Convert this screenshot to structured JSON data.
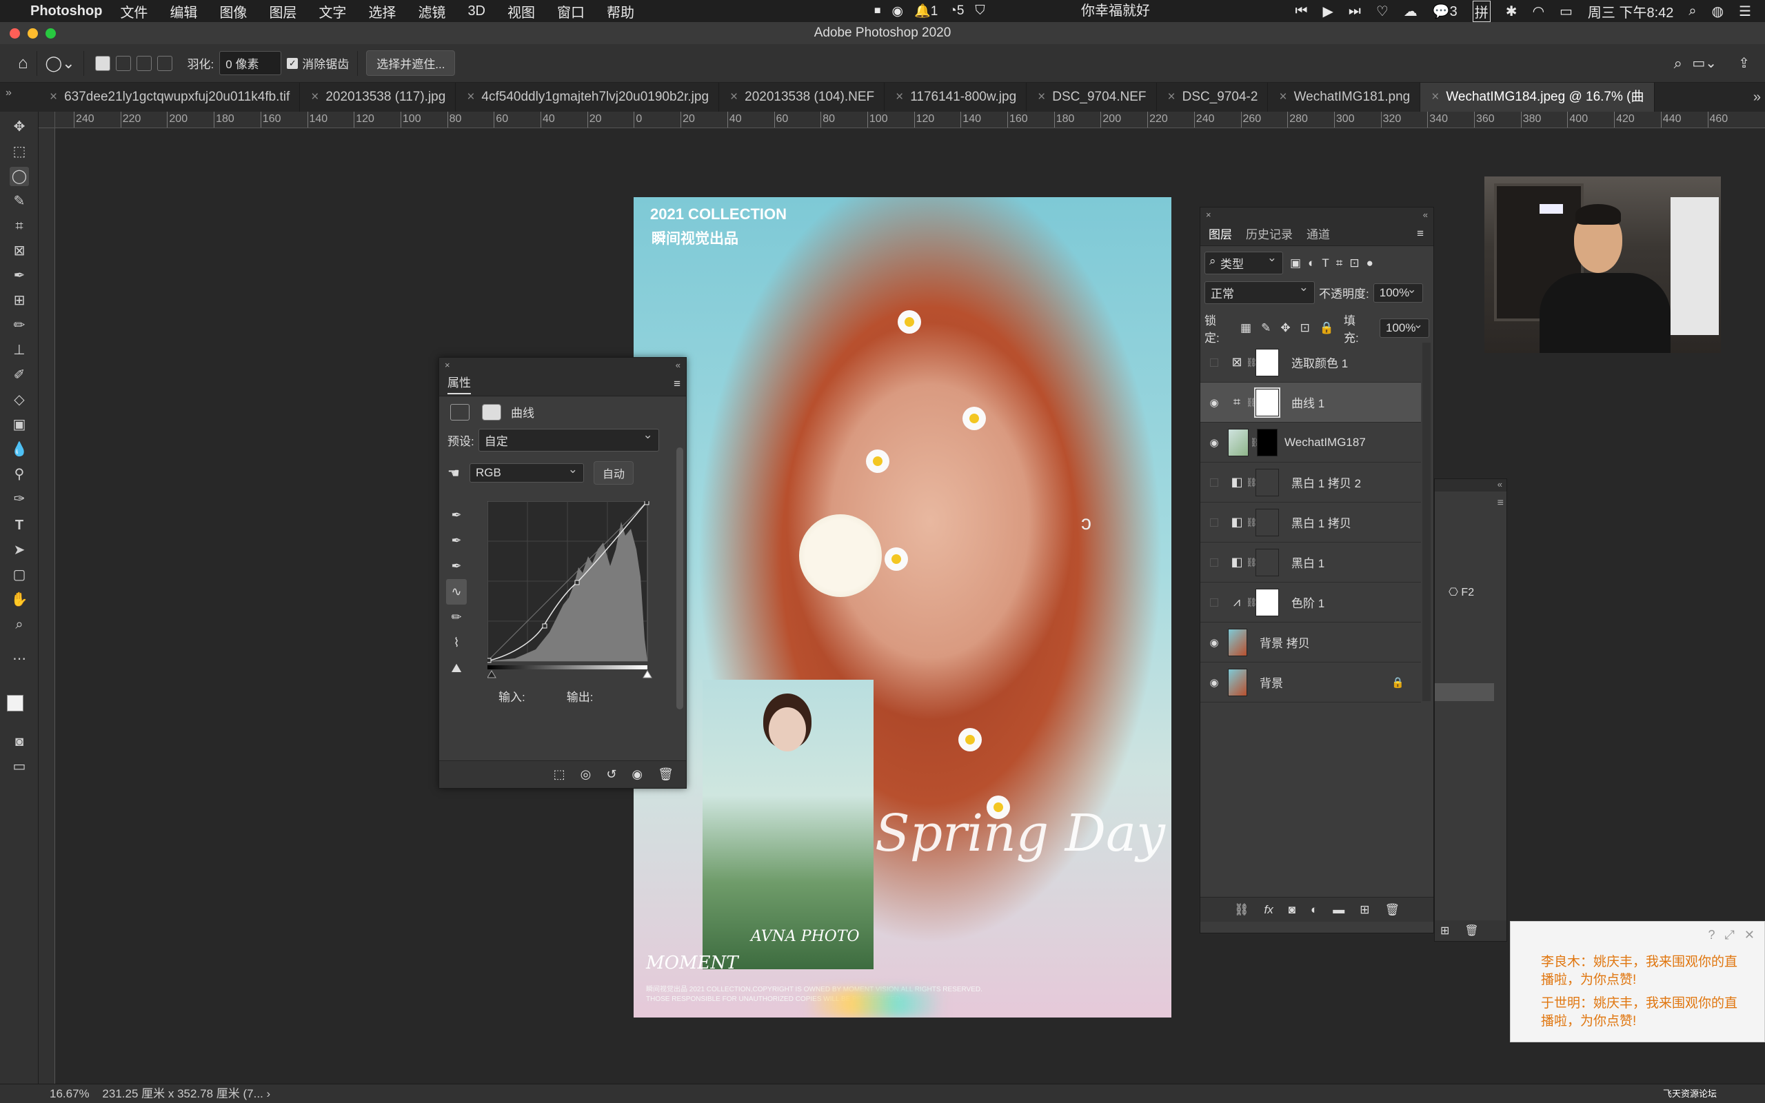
{
  "menubar": {
    "app": "Photoshop",
    "items": [
      "文件",
      "编辑",
      "图像",
      "图层",
      "文字",
      "选择",
      "滤镜",
      "3D",
      "视图",
      "窗口",
      "帮助"
    ],
    "status_badge_1": "1",
    "status_badge_2": "5",
    "song": "你幸福就好",
    "wechat_count": "3",
    "input_method": "拼",
    "clock": "周三 下午8:42"
  },
  "window": {
    "title": "Adobe Photoshop 2020"
  },
  "options": {
    "feather_label": "羽化:",
    "feather_value": "0 像素",
    "antialias_label": "消除锯齿",
    "select_mask_button": "选择并遮住..."
  },
  "tabs": [
    "637dee21ly1gctqwupxfuj20u011k4fb.tif",
    "202013538 (117).jpg",
    "4cf540ddly1gmajteh7lvj20u0190b2r.jpg",
    "202013538 (104).NEF",
    "1176141-800w.jpg",
    "DSC_9704.NEF",
    "DSC_9704-2",
    "WechatIMG181.png",
    "WechatIMG184.jpeg @ 16.7% (曲"
  ],
  "ruler": {
    "h_labels": [
      "240",
      "220",
      "200",
      "180",
      "160",
      "140",
      "120",
      "100",
      "80",
      "60",
      "40",
      "20",
      "0",
      "20",
      "40",
      "60",
      "80",
      "100",
      "120",
      "140",
      "160",
      "180",
      "200",
      "220",
      "240",
      "260",
      "280",
      "300",
      "320",
      "340",
      "360",
      "380",
      "400",
      "420",
      "440",
      "460"
    ]
  },
  "poster": {
    "heading": "2021 COLLECTION",
    "subheading": "瞬间视觉出品",
    "script_text": "Spring Day",
    "brand": "MOMENT",
    "inset_brand": "AVNA PHOTO",
    "footer_line1": "瞬间视觉出品 2021 COLLECTION,COPYRIGHT IS OWNED BY MOMENT VISION.ALL RIGHTS RESERVED.",
    "footer_line2": "THOSE RESPONSIBLE FOR UNAUTHORIZED COPIES WILL BE PROSECUTED."
  },
  "properties": {
    "tab": "属性",
    "type_label": "曲线",
    "preset_label": "预设:",
    "preset_value": "自定",
    "channel": "RGB",
    "auto_button": "自动",
    "input_label": "输入:",
    "output_label": "输出:"
  },
  "layers_panel": {
    "tabs": [
      "图层",
      "历史记录",
      "通道"
    ],
    "filter_kind": "类型",
    "blend_mode": "正常",
    "opacity_label": "不透明度:",
    "opacity": "100%",
    "lock_label": "锁定:",
    "fill_label": "填充:",
    "fill": "100%",
    "layers": [
      {
        "name": "选取颜色 1",
        "visible": false,
        "kind": "adjustment"
      },
      {
        "name": "曲线 1",
        "visible": true,
        "kind": "adjustment",
        "selected": true
      },
      {
        "name": "WechatIMG187",
        "visible": true,
        "kind": "smart"
      },
      {
        "name": "黑白 1 拷贝 2",
        "visible": false,
        "kind": "adjustment"
      },
      {
        "name": "黑白 1 拷贝",
        "visible": false,
        "kind": "adjustment"
      },
      {
        "name": "黑白 1",
        "visible": false,
        "kind": "adjustment"
      },
      {
        "name": "色阶 1",
        "visible": false,
        "kind": "adjustment"
      },
      {
        "name": "背景 拷贝",
        "visible": true,
        "kind": "image"
      },
      {
        "name": "背景",
        "visible": true,
        "kind": "image",
        "locked": true
      }
    ]
  },
  "back_panel": {
    "shortcut": "F2"
  },
  "notification": {
    "msg1": "李良木：姚庆丰，我来围观你的直播啦，为你点赞!",
    "msg2": "于世明：姚庆丰，我来围观你的直播啦，为你点赞!",
    "watermark": "飞天资源论坛"
  },
  "status": {
    "zoom": "16.67%",
    "doc_size": "231.25 厘米 x 352.78 厘米 (7..."
  }
}
